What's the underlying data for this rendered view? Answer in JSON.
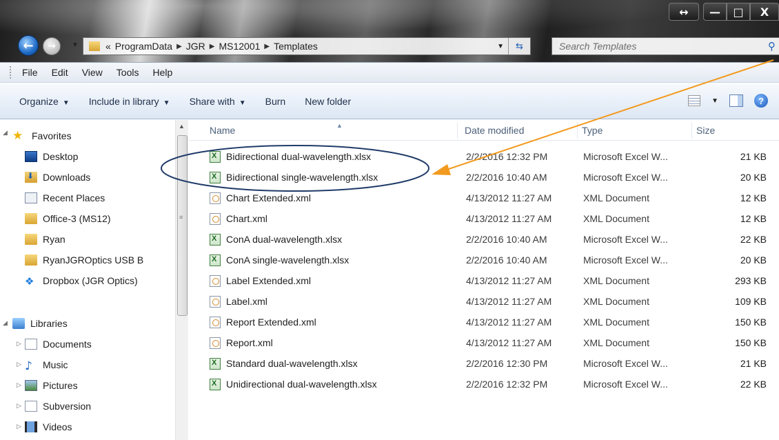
{
  "window": {
    "caption_buttons": {
      "resize": "↔",
      "minimize": "—",
      "maximize": "□",
      "close": "X"
    }
  },
  "nav": {
    "breadcrumb_prefix": "«",
    "path": [
      "ProgramData",
      "JGR",
      "MS12001",
      "Templates"
    ],
    "search_placeholder": "Search Templates"
  },
  "menu": [
    "File",
    "Edit",
    "View",
    "Tools",
    "Help"
  ],
  "commands": [
    {
      "label": "Organize",
      "has_dropdown": true
    },
    {
      "label": "Include in library",
      "has_dropdown": true
    },
    {
      "label": "Share with",
      "has_dropdown": true
    },
    {
      "label": "Burn",
      "has_dropdown": false
    },
    {
      "label": "New folder",
      "has_dropdown": false
    }
  ],
  "sidebar": {
    "favorites_label": "Favorites",
    "favorites": [
      {
        "label": "Desktop",
        "icon": "desktop-icon"
      },
      {
        "label": "Downloads",
        "icon": "downloads-icon"
      },
      {
        "label": "Recent Places",
        "icon": "recent-places-icon"
      },
      {
        "label": "Office-3 (MS12)",
        "icon": "folder-icon"
      },
      {
        "label": "Ryan",
        "icon": "folder-icon"
      },
      {
        "label": "RyanJGROptics USB B",
        "icon": "folder-icon"
      },
      {
        "label": "Dropbox (JGR Optics)",
        "icon": "dropbox-icon"
      }
    ],
    "libraries_label": "Libraries",
    "libraries": [
      {
        "label": "Documents",
        "icon": "documents-icon"
      },
      {
        "label": "Music",
        "icon": "music-icon"
      },
      {
        "label": "Pictures",
        "icon": "pictures-icon"
      },
      {
        "label": "Subversion",
        "icon": "subversion-icon"
      },
      {
        "label": "Videos",
        "icon": "videos-icon"
      }
    ]
  },
  "columns": {
    "name": "Name",
    "date": "Date modified",
    "type": "Type",
    "size": "Size"
  },
  "files": [
    {
      "name": "Bidirectional dual-wavelength.xlsx",
      "date": "2/2/2016 12:32 PM",
      "type": "Microsoft Excel W...",
      "size": "21 KB",
      "kind": "xlsx"
    },
    {
      "name": "Bidirectional single-wavelength.xlsx",
      "date": "2/2/2016 10:40 AM",
      "type": "Microsoft Excel W...",
      "size": "20 KB",
      "kind": "xlsx"
    },
    {
      "name": "Chart Extended.xml",
      "date": "4/13/2012 11:27 AM",
      "type": "XML Document",
      "size": "12 KB",
      "kind": "xml"
    },
    {
      "name": "Chart.xml",
      "date": "4/13/2012 11:27 AM",
      "type": "XML Document",
      "size": "12 KB",
      "kind": "xml"
    },
    {
      "name": "ConA dual-wavelength.xlsx",
      "date": "2/2/2016 10:40 AM",
      "type": "Microsoft Excel W...",
      "size": "22 KB",
      "kind": "xlsx"
    },
    {
      "name": "ConA single-wavelength.xlsx",
      "date": "2/2/2016 10:40 AM",
      "type": "Microsoft Excel W...",
      "size": "20 KB",
      "kind": "xlsx"
    },
    {
      "name": "Label Extended.xml",
      "date": "4/13/2012 11:27 AM",
      "type": "XML Document",
      "size": "293 KB",
      "kind": "xml"
    },
    {
      "name": "Label.xml",
      "date": "4/13/2012 11:27 AM",
      "type": "XML Document",
      "size": "109 KB",
      "kind": "xml"
    },
    {
      "name": "Report Extended.xml",
      "date": "4/13/2012 11:27 AM",
      "type": "XML Document",
      "size": "150 KB",
      "kind": "xml"
    },
    {
      "name": "Report.xml",
      "date": "4/13/2012 11:27 AM",
      "type": "XML Document",
      "size": "150 KB",
      "kind": "xml"
    },
    {
      "name": "Standard dual-wavelength.xlsx",
      "date": "2/2/2016 12:30 PM",
      "type": "Microsoft Excel W...",
      "size": "21 KB",
      "kind": "xlsx"
    },
    {
      "name": "Unidirectional dual-wavelength.xlsx",
      "date": "2/2/2016 12:32 PM",
      "type": "Microsoft Excel W...",
      "size": "22 KB",
      "kind": "xlsx"
    }
  ],
  "annotation": {
    "ellipse_color": "#1f3a68",
    "arrow_color": "#f29a1f"
  }
}
